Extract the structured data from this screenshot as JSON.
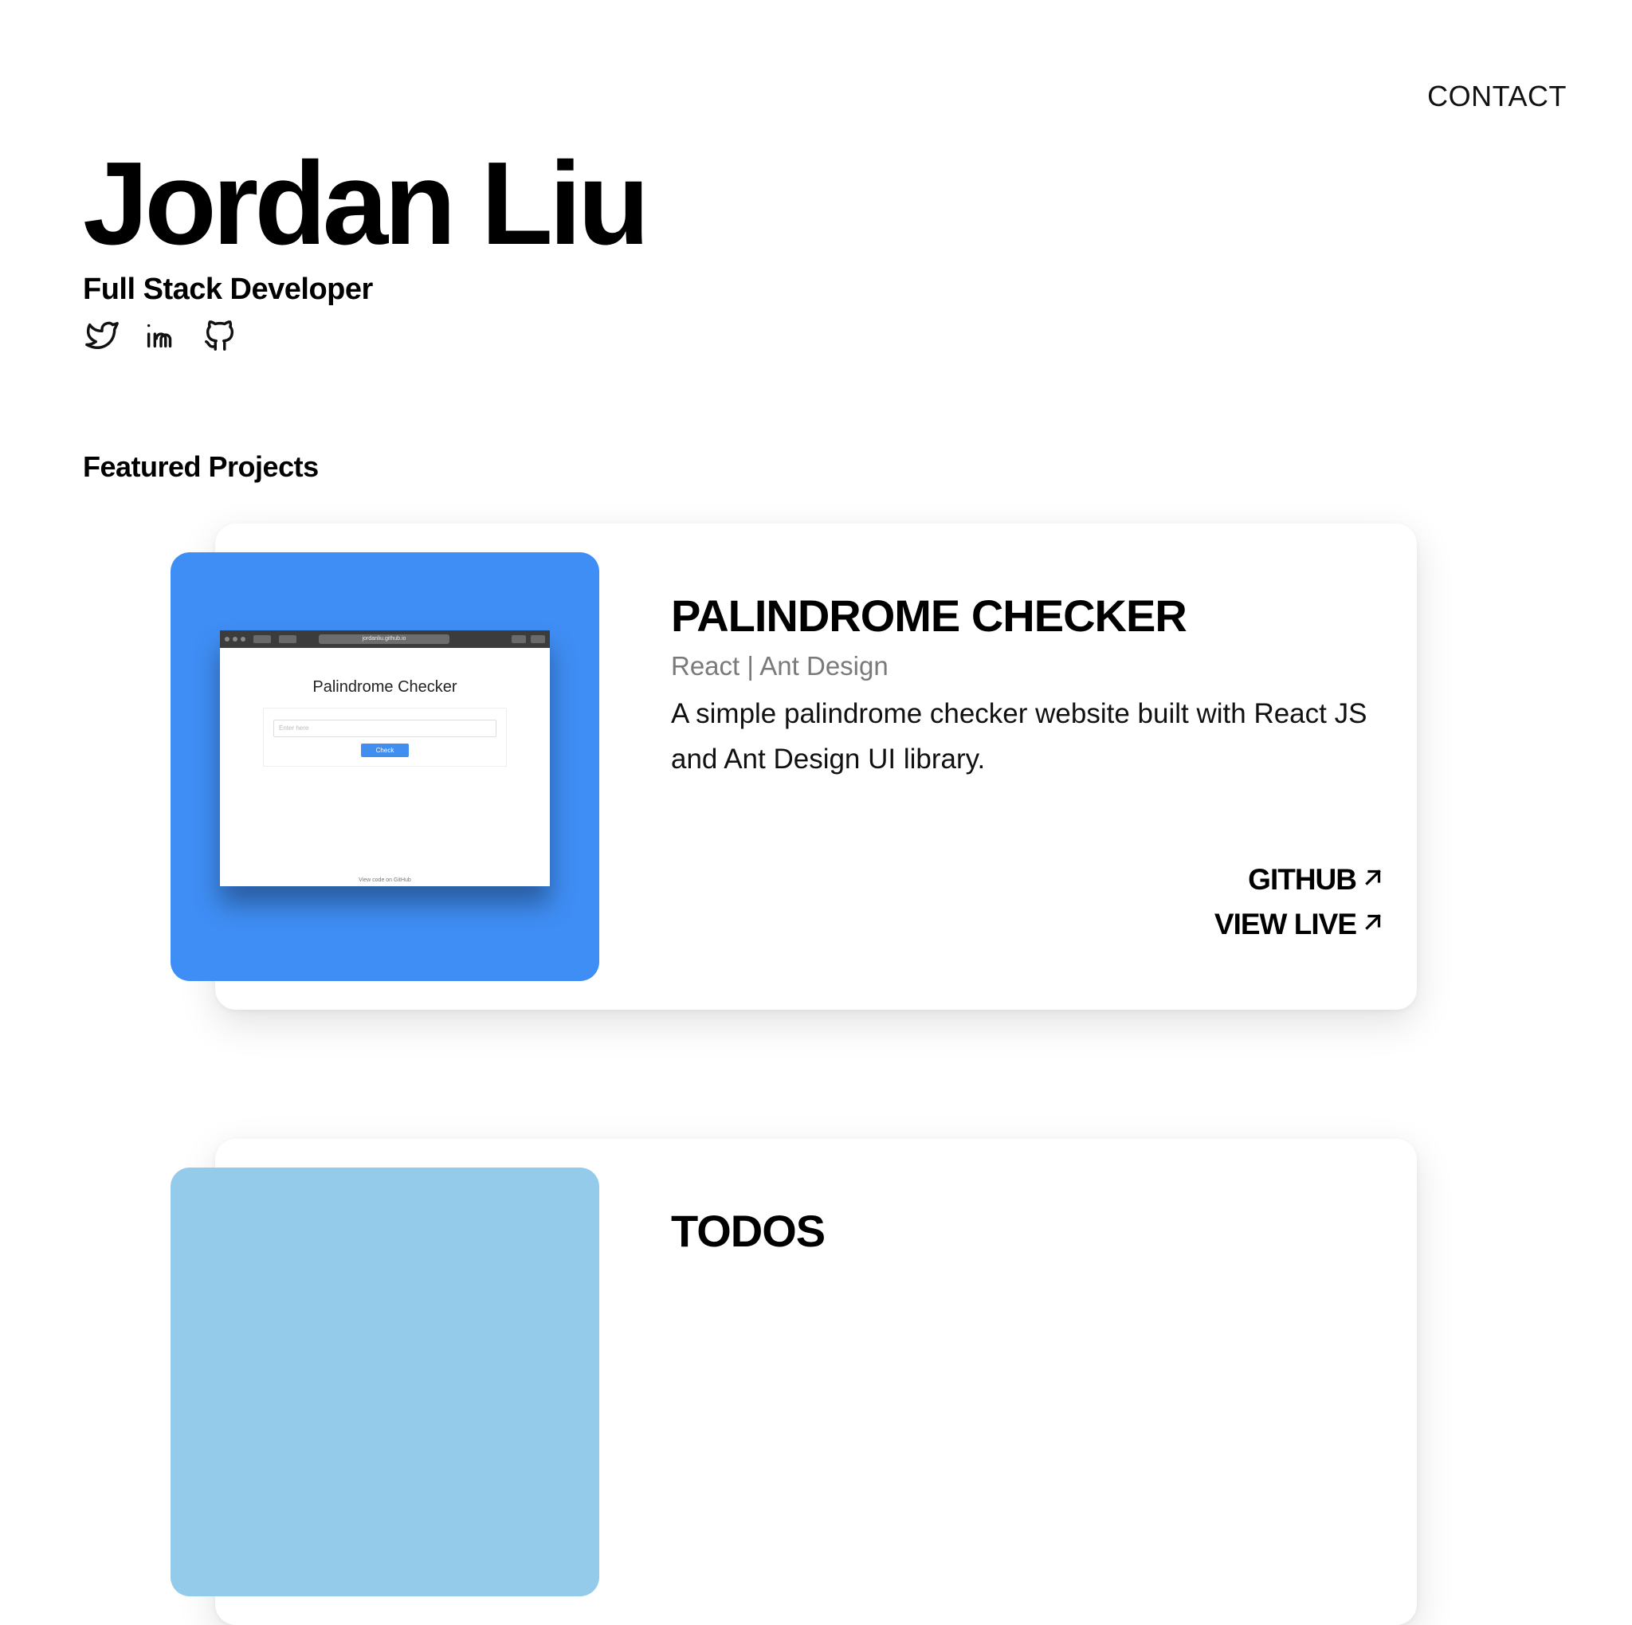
{
  "nav": {
    "contact_label": "CONTACT"
  },
  "hero": {
    "name": "Jordan Liu",
    "role": "Full Stack Developer",
    "socials": [
      {
        "icon": "twitter-icon"
      },
      {
        "icon": "linkedin-icon"
      },
      {
        "icon": "github-icon"
      }
    ]
  },
  "projects_section": {
    "heading": "Featured Projects"
  },
  "projects": [
    {
      "title": "PALINDROME CHECKER",
      "tech": "React | Ant Design",
      "description": "A simple palindrome checker website built with React JS and Ant Design UI library.",
      "thumb_color": "#3f8ef5",
      "screenshot": {
        "url": "jordanliu.github.io",
        "title": "Palindrome Checker",
        "input_placeholder": "Enter here",
        "button_label": "Check",
        "footer": "View code on GitHub"
      },
      "links": [
        {
          "label": "GITHUB",
          "icon": "arrow-up-right-icon"
        },
        {
          "label": "VIEW LIVE",
          "icon": "arrow-up-right-icon"
        }
      ]
    },
    {
      "title": "TODOS",
      "thumb_color": "#94cbea"
    }
  ]
}
